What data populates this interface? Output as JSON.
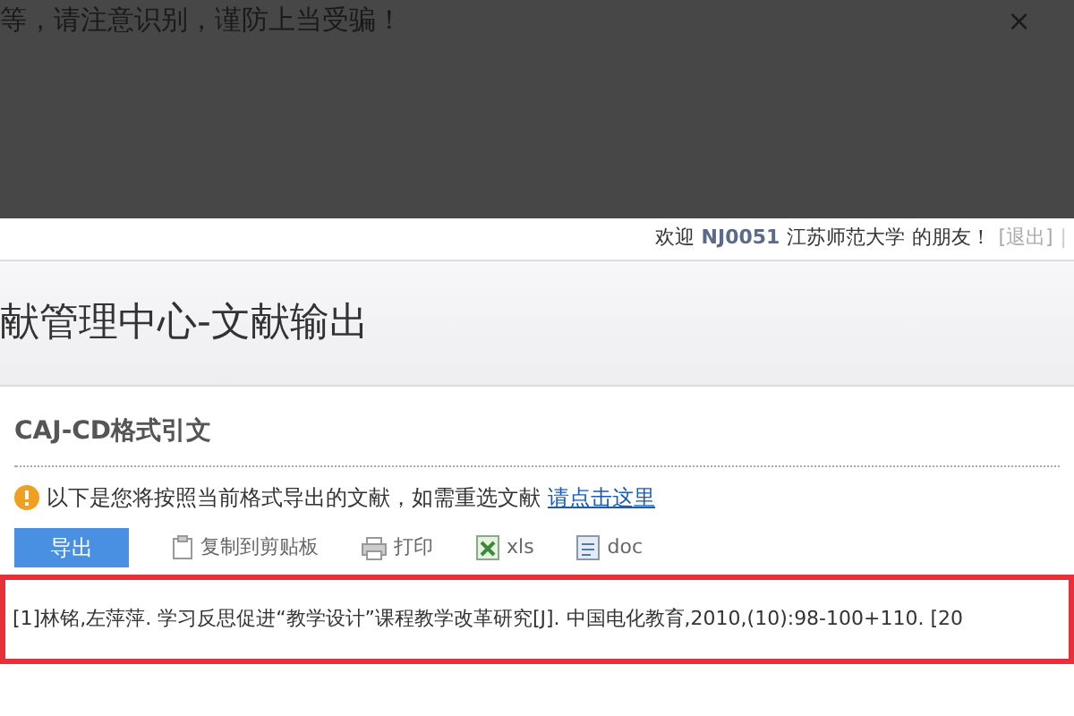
{
  "overlay_notice": {
    "text": "等，请注意识别，谨防上当受骗！",
    "close": "×"
  },
  "welcome": {
    "greeting": "欢迎",
    "user_id": "NJ0051",
    "org": "江苏师范大学",
    "suffix": "的朋友！",
    "logout": "[退出]",
    "separator": "|"
  },
  "page_title": "献管理中心-文献输出",
  "section_title": "CAJ-CD格式引文",
  "notice": {
    "text": "以下是您将按照当前格式导出的文献，如需重选文献",
    "link": "请点击这里"
  },
  "toolbar": [
    {
      "label": "导出",
      "kind": "primary"
    },
    {
      "label": "复制到剪贴板",
      "kind": "copy"
    },
    {
      "label": "打印",
      "kind": "print"
    },
    {
      "label": "xls",
      "kind": "xls"
    },
    {
      "label": "doc",
      "kind": "doc"
    }
  ],
  "citation_box": {
    "highlighted": true,
    "citations": [
      "[1]林铭,左萍萍. 学习反思促进“教学设计”课程教学改革研究[J]. 中国电化教育,2010,(10):98-100+110. [20"
    ]
  }
}
